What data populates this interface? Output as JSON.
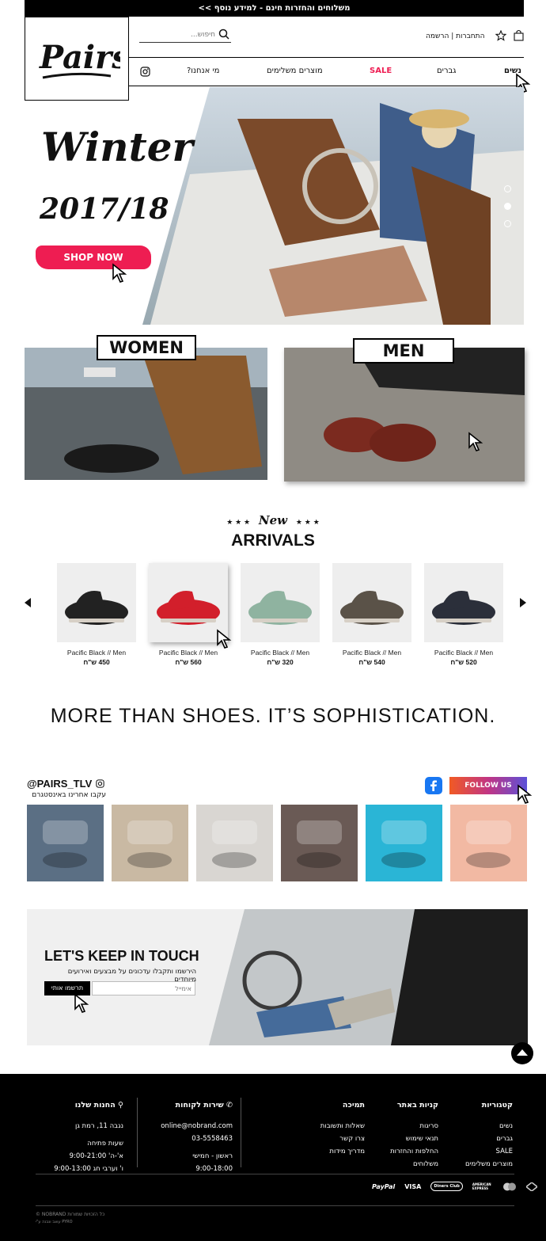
{
  "topbar": {
    "text": "משלוחים והחזרות חינם - למידע נוסף >>"
  },
  "header": {
    "logo": "Pairs",
    "search_placeholder": "חיפוש...",
    "login": "התחברות",
    "separator": "|",
    "register": "הרשמה"
  },
  "nav": {
    "women": "נשים",
    "men": "גברים",
    "sale": "SALE",
    "accessories": "מוצרים משלימים",
    "about": "מי אנחנו?"
  },
  "hero": {
    "title": "Winter",
    "year": "2017/18",
    "cta": "SHOP NOW"
  },
  "categories": {
    "women": "WOMEN",
    "men": "MEN"
  },
  "new_arrivals": {
    "stars_left": "★ ★ ★",
    "script": "New",
    "stars_right": "★ ★ ★",
    "title": "ARRIVALS"
  },
  "products": [
    {
      "name": "Pacific Black // Men",
      "price": "450 ש\"ח",
      "color": "#222"
    },
    {
      "name": "Pacific Black // Men",
      "price": "560 ש\"ח",
      "color": "#d21f2b"
    },
    {
      "name": "Pacific Black // Men",
      "price": "320 ש\"ח",
      "color": "#8fb3a0"
    },
    {
      "name": "Pacific Black // Men",
      "price": "540 ש\"ח",
      "color": "#5a5248"
    },
    {
      "name": "Pacific Black // Men",
      "price": "520 ש\"ח",
      "color": "#2b2f3a"
    }
  ],
  "tagline": "MORE THAN SHOES. IT’S SOPHISTICATION.",
  "instagram": {
    "handle": "@PAIRS_TLV",
    "subtitle": "עקבו אחרינו באינסטגרם",
    "follow": "FOLLOW US",
    "tiles": [
      "#5b6f84",
      "#c9b9a3",
      "#d9d6d2",
      "#6a5a55",
      "#2ab5d6",
      "#f2b9a3"
    ]
  },
  "newsletter": {
    "title": "LET'S KEEP IN TOUCH",
    "subtitle": "הירשמו ותקבלו עדכונים על מבצעים ואירועים מיוחדים",
    "email_placeholder": "אימייל",
    "submit": "תרשמו אותי"
  },
  "footer": {
    "categories": {
      "title": "קטגוריות",
      "items": [
        "נשים",
        "גברים",
        "SALE",
        "מוצרים משלימים"
      ]
    },
    "shopping": {
      "title": "קניות באתר",
      "items": [
        "סריגות",
        "תנאי שימוש",
        "החלפות והחזרות",
        "משלוחים"
      ]
    },
    "support": {
      "title": "תמיכה",
      "items": [
        "שאלות ותשובות",
        "צרו קשר",
        "מדריך מידות"
      ]
    },
    "service": {
      "title": "שירות לקוחות",
      "email": "online@nobrand.com",
      "phone": "03-5558463",
      "days": "ראשון - חמישי",
      "hours": "9:00-18:00"
    },
    "stores": {
      "title": "החנות שלנו",
      "address": "נגבה 11, רמת גן",
      "hours_title": "שעות פתיחה",
      "weekday": "א'-ה' 9:00-21:00",
      "friday": "ו' וערבי חג 9:00-13:00"
    },
    "payments": [
      "PayPal",
      "VISA",
      "Diners Club",
      "AMERICAN EXPRESS"
    ],
    "copyright": "© NOBRAND כל הזכויות שמורות",
    "credit": "עוצב ונבנה ע\"י PYRO"
  },
  "colors": {
    "accent": "#ee1d52",
    "sale": "#ee1d52",
    "black": "#000000"
  }
}
